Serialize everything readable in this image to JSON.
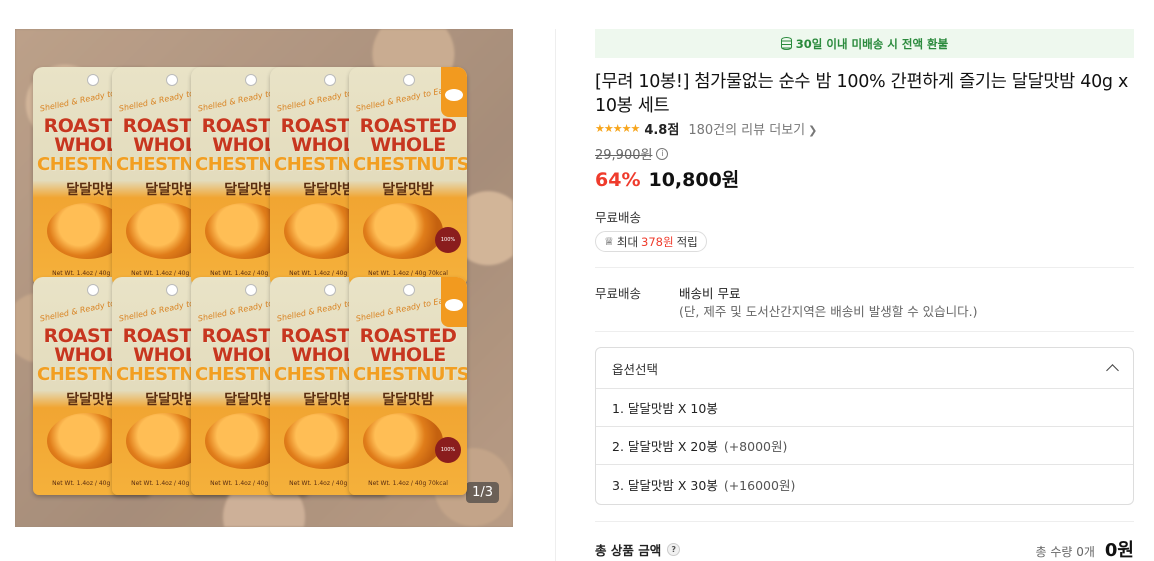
{
  "gallery": {
    "counter": "1/3",
    "pouch": {
      "tagline": "Shelled & Ready to Eat",
      "title_line1": "ROASTED",
      "title_line2": "WHOLE",
      "title_line3": "CHESTNUTS",
      "korean_name": "달달맛밤",
      "badge": "100%",
      "net_weight": "Net Wt. 1.4oz / 40g 70kcal"
    }
  },
  "notice": {
    "icon": "coin-stack-icon",
    "text": "30일 이내 미배송 시 전액 환불",
    "color": "#2a8a3c"
  },
  "product": {
    "title": "[무려 10봉!] 첨가물없는 순수 밤 100% 간편하게 즐기는 달달맛밤 40g x 10봉 세트",
    "stars": "★★★★★",
    "score": "4.8점",
    "reviews": "180건의 리뷰 더보기",
    "original_price": "29,900원",
    "discount": "64%",
    "price": "10,800원",
    "discount_color": "#ef3b2c"
  },
  "shipping": {
    "label_top": "무료배송",
    "points_prefix": "최대",
    "points_amount": "378원",
    "points_suffix": "적립",
    "label": "무료배송",
    "fee": "배송비 무료",
    "note": "(단, 제주 및 도서산간지역은 배송비 발생할 수 있습니다.)"
  },
  "options": {
    "header": "옵션선택",
    "items": [
      {
        "label": "1. 달달맛밤 X 10봉",
        "extra": ""
      },
      {
        "label": "2. 달달맛밤 X 20봉",
        "extra": "(+8000원)"
      },
      {
        "label": "3. 달달맛밤 X 30봉",
        "extra": "(+16000원)"
      }
    ]
  },
  "summary": {
    "total_label": "총 상품 금액",
    "help": "?",
    "quantity": "총 수량 0개",
    "total": "0원"
  }
}
